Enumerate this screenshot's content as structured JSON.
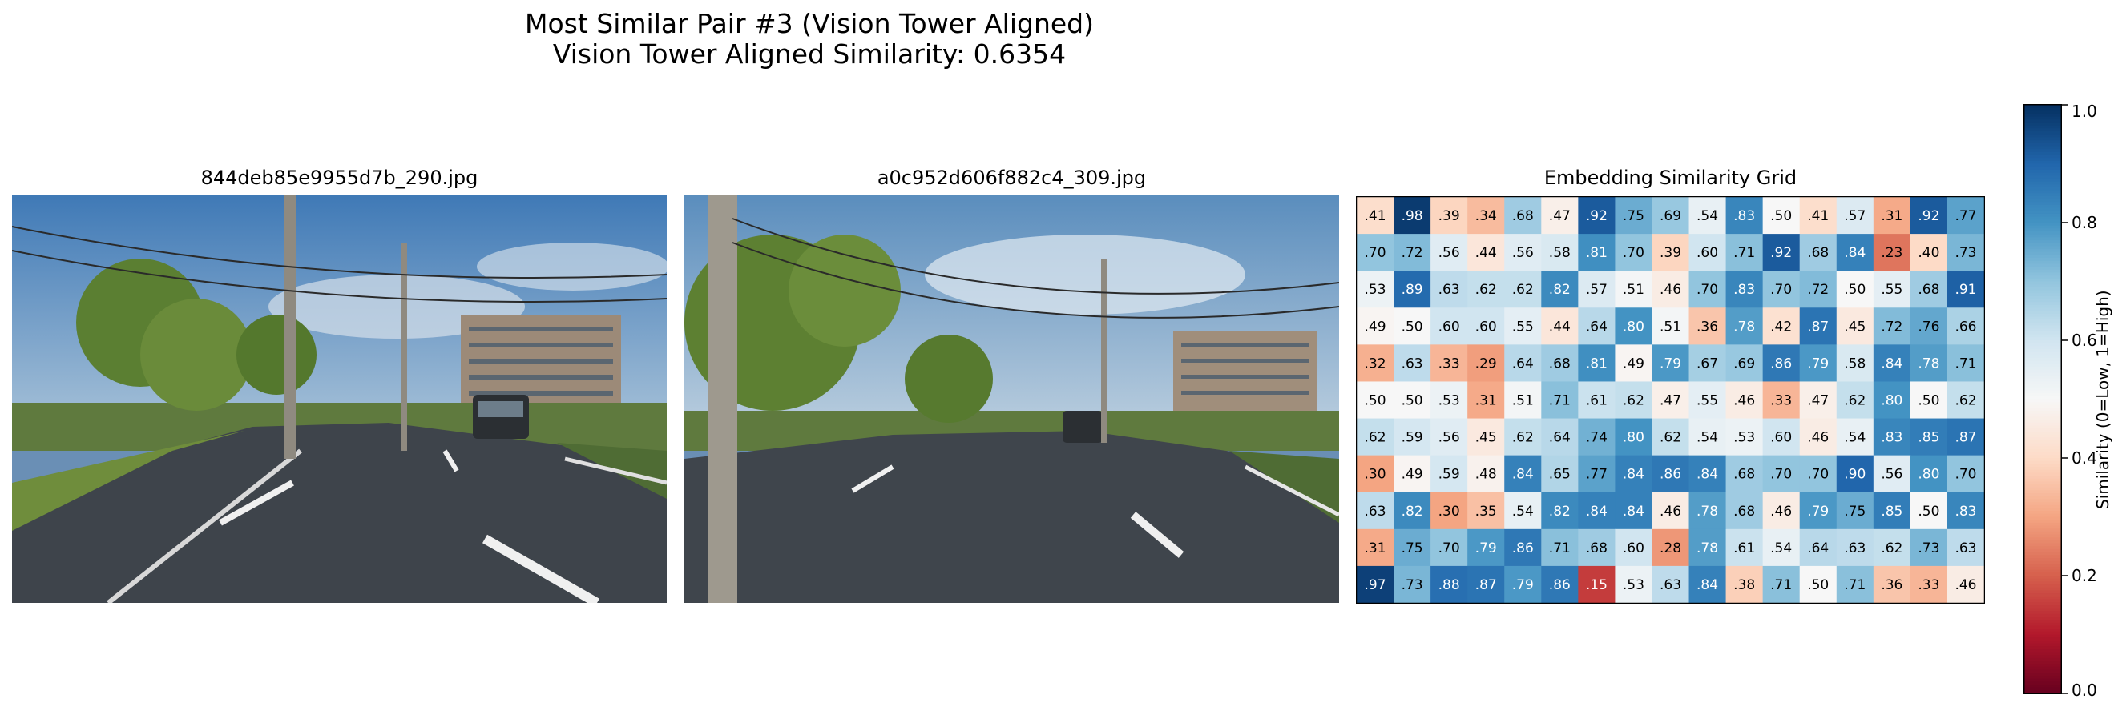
{
  "figure": {
    "title_line1": "Most Similar Pair #3 (Vision Tower Aligned)",
    "title_line2": "Vision Tower Aligned Similarity: 0.6354"
  },
  "images": {
    "left_name": "844deb85e9955d7b_290.jpg",
    "right_name": "a0c952d606f882c4_309.jpg"
  },
  "chart_data": {
    "type": "heatmap",
    "title": "Embedding Similarity Grid",
    "colorbar_label": "Similarity (0=Low, 1=High)",
    "colorbar_ticks": [
      "0.0",
      "0.2",
      "0.4",
      "0.6",
      "0.8",
      "1.0"
    ],
    "vmin": 0.0,
    "vmax": 1.0,
    "colormap": "RdBu",
    "rows": 11,
    "cols": 17,
    "values": [
      [
        0.41,
        0.98,
        0.39,
        0.34,
        0.68,
        0.47,
        0.92,
        0.75,
        0.69,
        0.54,
        0.83,
        0.5,
        0.41,
        0.57,
        0.31,
        0.92,
        0.77
      ],
      [
        0.7,
        0.72,
        0.56,
        0.44,
        0.56,
        0.58,
        0.81,
        0.7,
        0.39,
        0.6,
        0.71,
        0.92,
        0.68,
        0.84,
        0.23,
        0.4,
        0.73
      ],
      [
        0.53,
        0.89,
        0.63,
        0.62,
        0.62,
        0.82,
        0.57,
        0.51,
        0.46,
        0.7,
        0.83,
        0.7,
        0.72,
        0.5,
        0.55,
        0.68,
        0.91
      ],
      [
        0.49,
        0.5,
        0.6,
        0.6,
        0.55,
        0.44,
        0.64,
        0.8,
        0.51,
        0.36,
        0.78,
        0.42,
        0.87,
        0.45,
        0.72,
        0.76,
        0.66
      ],
      [
        0.32,
        0.63,
        0.33,
        0.29,
        0.64,
        0.68,
        0.81,
        0.49,
        0.79,
        0.67,
        0.69,
        0.86,
        0.79,
        0.58,
        0.84,
        0.78,
        0.71
      ],
      [
        0.5,
        0.5,
        0.53,
        0.31,
        0.51,
        0.71,
        0.61,
        0.62,
        0.47,
        0.55,
        0.46,
        0.33,
        0.47,
        0.62,
        0.8,
        0.5,
        0.62
      ],
      [
        0.62,
        0.59,
        0.56,
        0.45,
        0.62,
        0.64,
        0.74,
        0.8,
        0.62,
        0.54,
        0.53,
        0.6,
        0.46,
        0.54,
        0.83,
        0.85,
        0.87
      ],
      [
        0.3,
        0.49,
        0.59,
        0.48,
        0.84,
        0.65,
        0.77,
        0.84,
        0.86,
        0.84,
        0.68,
        0.7,
        0.7,
        0.9,
        0.56,
        0.8,
        0.7
      ],
      [
        0.63,
        0.82,
        0.3,
        0.35,
        0.54,
        0.82,
        0.84,
        0.84,
        0.46,
        0.78,
        0.68,
        0.46,
        0.79,
        0.75,
        0.85,
        0.5,
        0.83
      ],
      [
        0.31,
        0.75,
        0.7,
        0.79,
        0.86,
        0.71,
        0.68,
        0.6,
        0.28,
        0.78,
        0.61,
        0.54,
        0.64,
        0.63,
        0.62,
        0.73,
        0.63
      ],
      [
        0.97,
        0.73,
        0.88,
        0.87,
        0.79,
        0.86,
        0.15,
        0.53,
        0.63,
        0.84,
        0.38,
        0.71,
        0.5,
        0.71,
        0.36,
        0.33,
        0.46
      ]
    ]
  }
}
